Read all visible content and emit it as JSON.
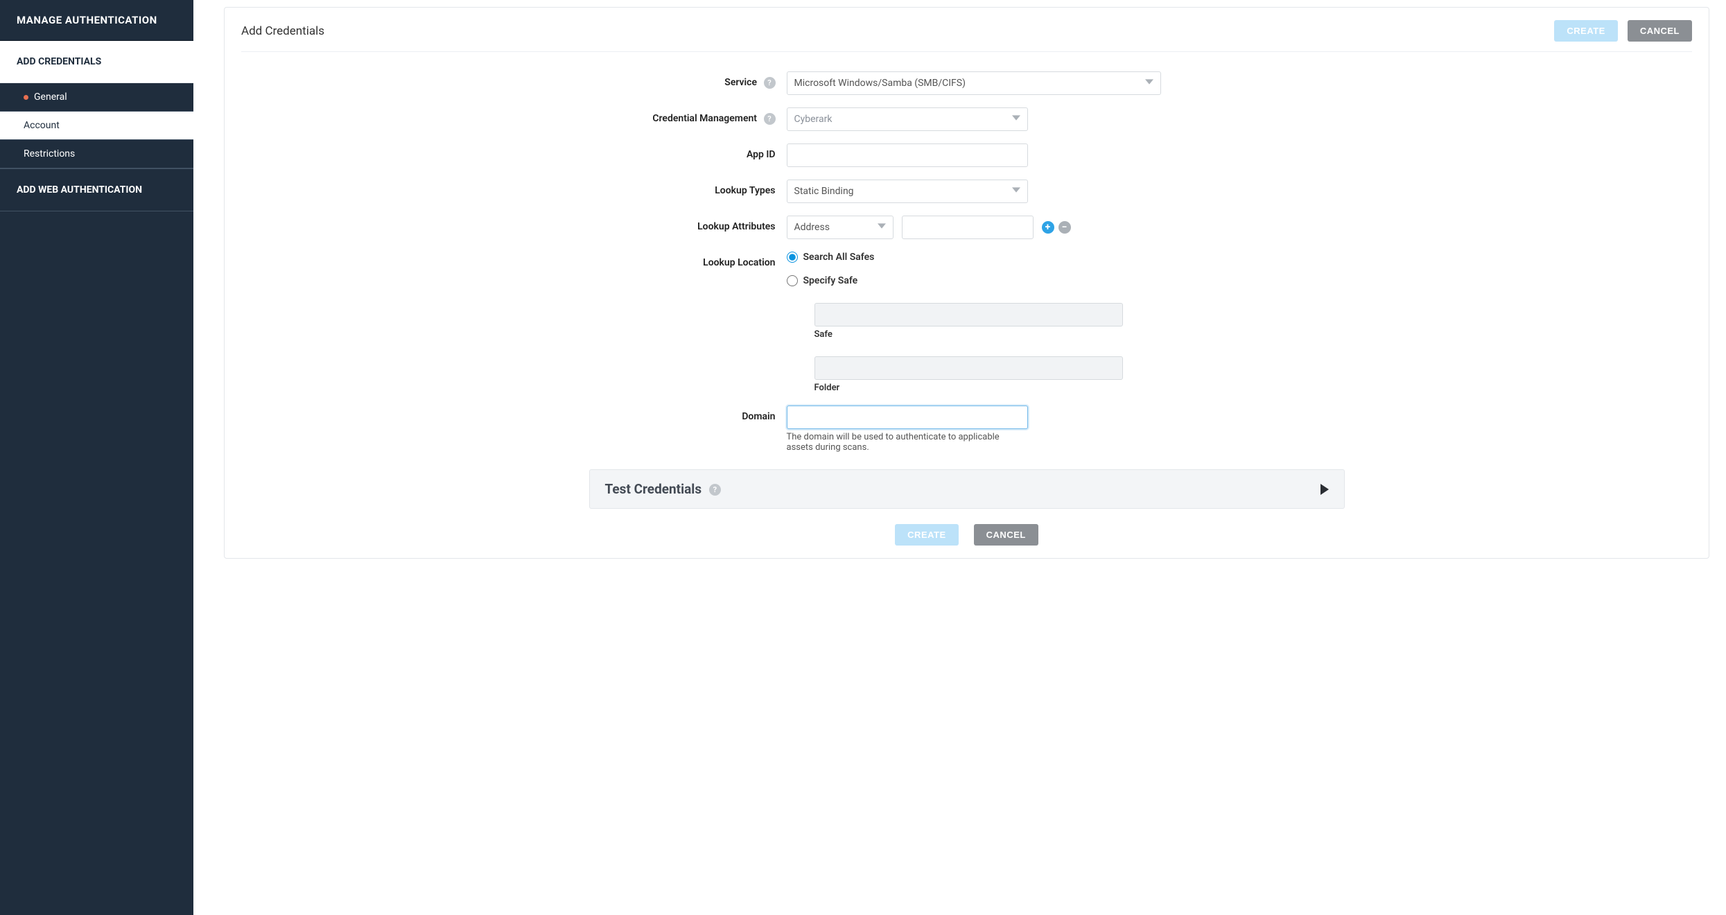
{
  "sidebar": {
    "header": "MANAGE AUTHENTICATION",
    "group1": "ADD CREDENTIALS",
    "items": [
      {
        "label": "General"
      },
      {
        "label": "Account"
      },
      {
        "label": "Restrictions"
      }
    ],
    "group2": "ADD WEB AUTHENTICATION"
  },
  "header": {
    "title": "Add Credentials",
    "create": "CREATE",
    "cancel": "CANCEL"
  },
  "form": {
    "service_label": "Service",
    "service_value": "Microsoft Windows/Samba (SMB/CIFS)",
    "credmgmt_label": "Credential Management",
    "credmgmt_value": "Cyberark",
    "appid_label": "App ID",
    "lookup_types_label": "Lookup Types",
    "lookup_types_value": "Static Binding",
    "lookup_attrs_label": "Lookup Attributes",
    "lookup_attr_value": "Address",
    "lookup_location_label": "Lookup Location",
    "radio_search_all": "Search All Safes",
    "radio_specify": "Specify Safe",
    "safe_label": "Safe",
    "folder_label": "Folder",
    "domain_label": "Domain",
    "domain_help": "The domain will be used to authenticate to applicable assets during scans."
  },
  "test": {
    "title": "Test Credentials"
  },
  "footer": {
    "create": "CREATE",
    "cancel": "CANCEL"
  }
}
